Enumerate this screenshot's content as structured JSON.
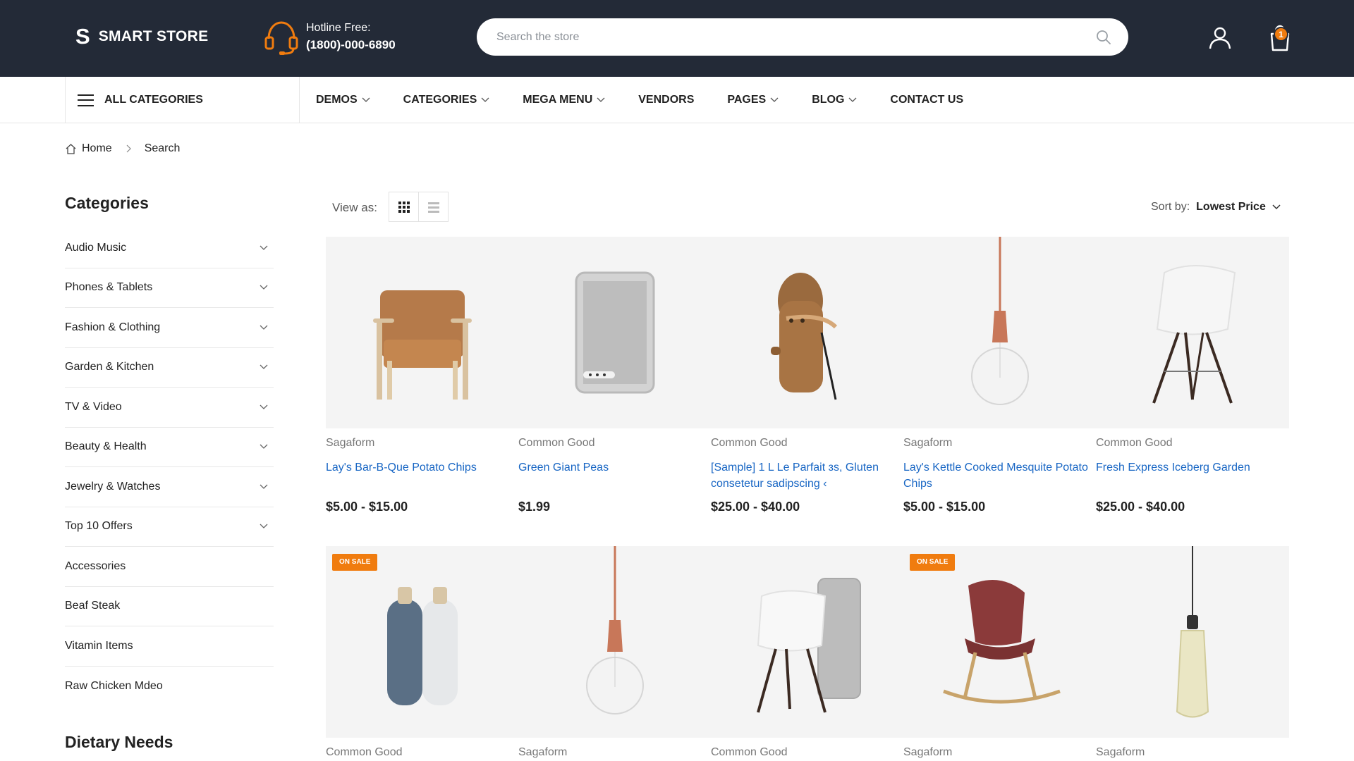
{
  "header": {
    "logo_mark": "S",
    "logo_text": "SMART STORE",
    "hotline_label": "Hotline Free:",
    "hotline_number": "(1800)-000-6890",
    "search_placeholder": "Search the store",
    "cart_count": "1",
    "icons": [
      "headset-icon",
      "search-icon",
      "user-icon",
      "shopping-bag-icon"
    ],
    "colors": {
      "bar": "#232a37",
      "accent": "#f07c0f"
    }
  },
  "nav": {
    "all_categories": "ALL CATEGORIES",
    "menu": [
      {
        "label": "DEMOS",
        "dropdown": true
      },
      {
        "label": "CATEGORIES",
        "dropdown": true
      },
      {
        "label": "MEGA MENU",
        "dropdown": true
      },
      {
        "label": "VENDORS",
        "dropdown": false
      },
      {
        "label": "PAGES",
        "dropdown": true
      },
      {
        "label": "BLOG",
        "dropdown": true
      },
      {
        "label": "CONTACT US",
        "dropdown": false
      }
    ]
  },
  "breadcrumb": {
    "home": "Home",
    "current": "Search"
  },
  "sidebar": {
    "title": "Categories",
    "categories": [
      {
        "label": "Audio Music",
        "expandable": true
      },
      {
        "label": "Phones & Tablets",
        "expandable": true
      },
      {
        "label": "Fashion & Clothing",
        "expandable": true
      },
      {
        "label": "Garden & Kitchen",
        "expandable": true
      },
      {
        "label": "TV & Video",
        "expandable": true
      },
      {
        "label": "Beauty & Health",
        "expandable": true
      },
      {
        "label": "Jewelry & Watches",
        "expandable": true
      },
      {
        "label": "Top 10 Offers",
        "expandable": true
      },
      {
        "label": "Accessories",
        "expandable": false
      },
      {
        "label": "Beaf Steak",
        "expandable": false
      },
      {
        "label": "Vitamin Items",
        "expandable": false
      },
      {
        "label": "Raw Chicken Mdeo",
        "expandable": false
      }
    ],
    "dietary_title": "Dietary Needs"
  },
  "toolbar": {
    "view_label": "View as:",
    "active_view": "grid",
    "sort_label": "Sort by:",
    "sort_value": "Lowest Price"
  },
  "products": [
    {
      "vendor": "Sagaform",
      "name": "Lay's Bar-B-Que Potato Chips",
      "price": "$5.00 - $15.00",
      "image": "leather-armchair",
      "badge": ""
    },
    {
      "vendor": "Common Good",
      "name": "Green Giant Peas",
      "price": "$1.99",
      "image": "fabric-speaker",
      "badge": ""
    },
    {
      "vendor": "Common Good",
      "name": "[Sample] 1 L Le Parfait ɜs, Gluten consetetur sadipscing ‹",
      "price": "$25.00 - $40.00",
      "image": "wooden-figure",
      "badge": ""
    },
    {
      "vendor": "Sagaform",
      "name": "Lay's Kettle Cooked Mesquite Potato Chips",
      "price": "$5.00 - $15.00",
      "image": "pendant-bulb-lamp",
      "badge": ""
    },
    {
      "vendor": "Common Good",
      "name": "Fresh Express Iceberg Garden",
      "price": "$25.00 - $40.00",
      "image": "white-eames-chair",
      "badge": ""
    },
    {
      "vendor": "Common Good",
      "name": "",
      "price": "",
      "image": "salt-pepper-grinders",
      "badge": "ON SALE"
    },
    {
      "vendor": "Sagaform",
      "name": "",
      "price": "",
      "image": "pendant-bulb-lamp",
      "badge": ""
    },
    {
      "vendor": "Common Good",
      "name": "",
      "price": "",
      "image": "white-chair-and-speaker",
      "badge": ""
    },
    {
      "vendor": "Sagaform",
      "name": "",
      "price": "",
      "image": "red-rocking-chair",
      "badge": "ON SALE"
    },
    {
      "vendor": "Sagaform",
      "name": "",
      "price": "",
      "image": "glass-pendant-lamp",
      "badge": ""
    }
  ]
}
